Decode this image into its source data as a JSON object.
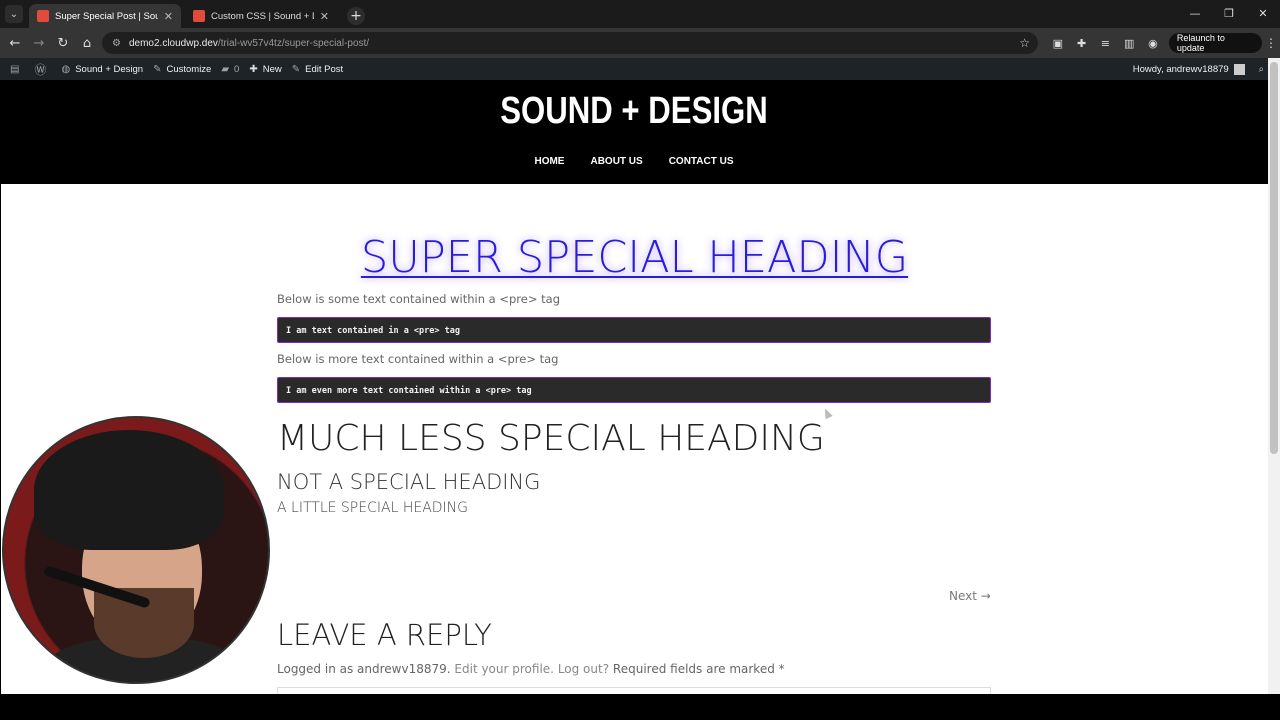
{
  "browser": {
    "tabs": [
      {
        "title": "Super Special Post | Sound + Design"
      },
      {
        "title": "Custom CSS | Sound + Design"
      }
    ],
    "url_host": "demo2.cloudwp.dev",
    "url_path": "/trial-wv57v4tz/super-special-post/",
    "relaunch_label": "Relaunch to update"
  },
  "admin_bar": {
    "site_name": "Sound + Design",
    "customize": "Customize",
    "comments_count": "0",
    "new": "New",
    "edit_post": "Edit Post",
    "howdy": "Howdy, andrewv18879"
  },
  "site": {
    "title": "SOUND + DESIGN",
    "nav": [
      "HOME",
      "ABOUT US",
      "CONTACT US"
    ]
  },
  "post": {
    "super_heading": "SUPER SPECIAL HEADING",
    "text1": "Below is some text contained within a <pre> tag",
    "pre1": "I am text contained in a <pre> tag",
    "text2": "Below is more text contained within a <pre> tag",
    "pre2": "I am even more text contained within a <pre> tag",
    "h_much": "MUCH LESS SPECIAL HEADING",
    "h_not": "NOT A SPECIAL HEADING",
    "h_little": "A LITTLE SPECIAL HEADING",
    "next": "Next →"
  },
  "comments": {
    "title": "LEAVE A REPLY",
    "logged_prefix": "Logged in as andrewv18879.",
    "edit_profile": "Edit your profile.",
    "logout": "Log out?",
    "required": "Required fields are marked *"
  },
  "colors": {
    "heading_link": "#2b1cd6",
    "pre_border": "#7c2bd6",
    "pre_bg": "#2a2a2a"
  }
}
